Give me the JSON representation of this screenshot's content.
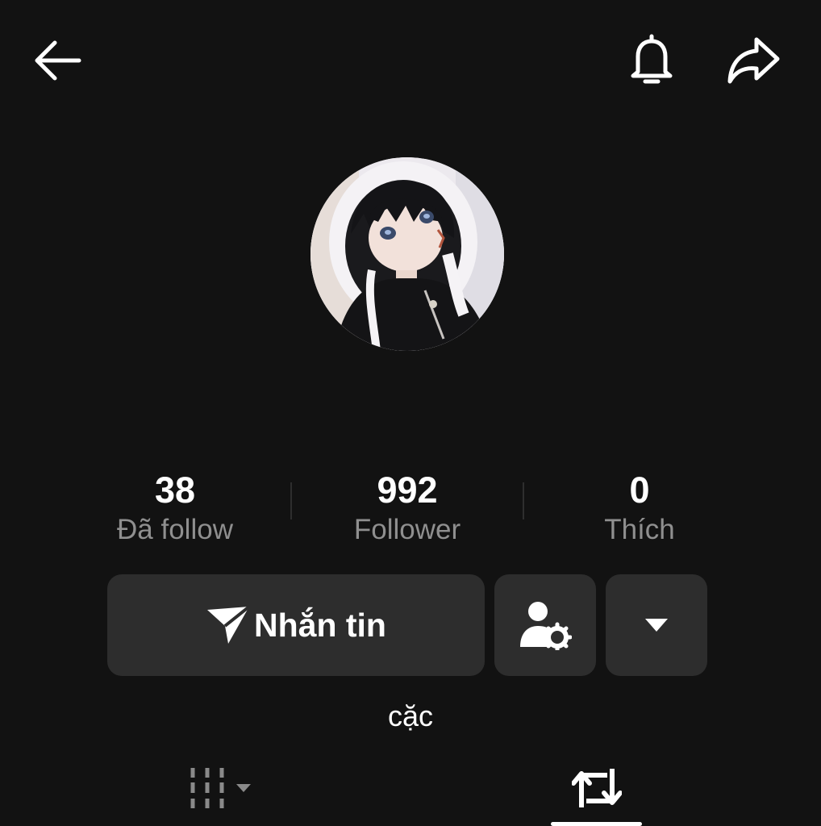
{
  "header": {
    "back_icon": "arrow-left-icon",
    "notification_icon": "bell-icon",
    "share_icon": "share-arrow-icon"
  },
  "profile": {
    "avatar": "doll-avatar-image"
  },
  "stats": {
    "following": {
      "value": "38",
      "label": "Đã follow"
    },
    "followers": {
      "value": "992",
      "label": "Follower"
    },
    "likes": {
      "value": "0",
      "label": "Thích"
    }
  },
  "actions": {
    "message_label": "Nhắn tin",
    "message_icon": "send-icon",
    "profile_settings_icon": "user-gear-icon",
    "more_icon": "caret-down-icon"
  },
  "bio": "cặc",
  "tabs": {
    "videos_icon": "grid-icon",
    "reposts_icon": "repost-icon",
    "active": "reposts"
  },
  "colors": {
    "background": "#121212",
    "button_bg": "#2d2d2d",
    "label_gray": "#8f8f8f",
    "text": "#ffffff"
  }
}
